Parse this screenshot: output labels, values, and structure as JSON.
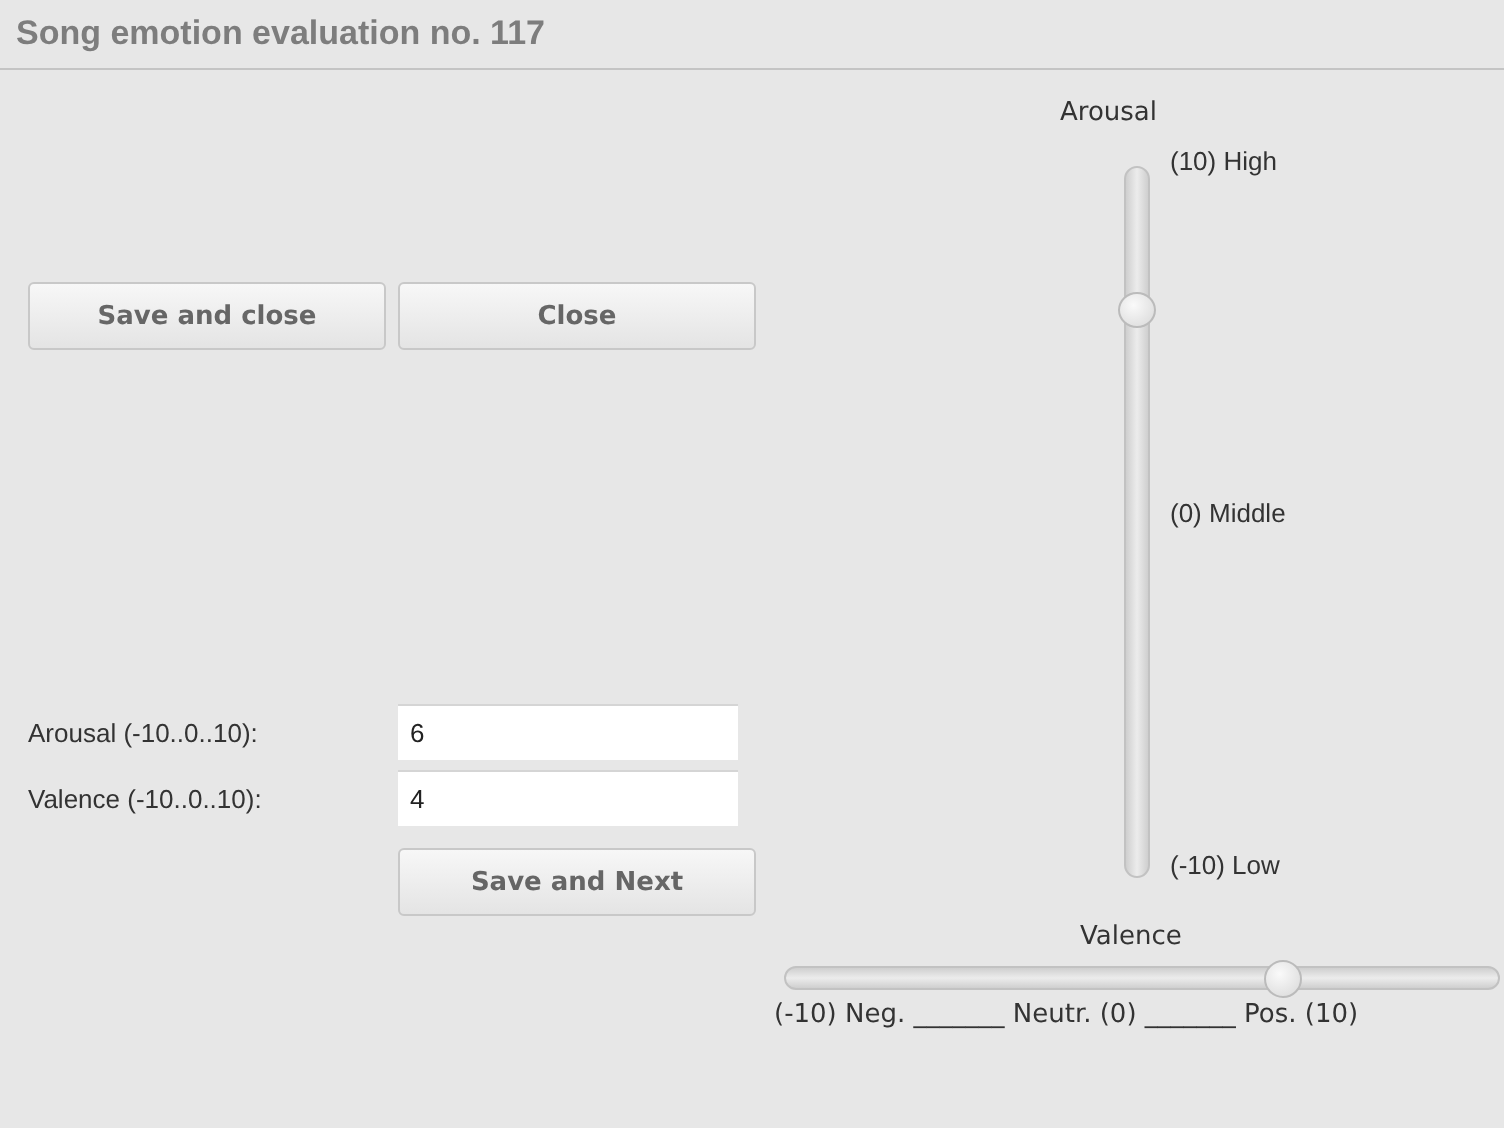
{
  "window": {
    "title": "Song emotion evaluation no. 117"
  },
  "actions": [
    {
      "label": "Save and close"
    },
    {
      "label": "Close"
    }
  ],
  "form": {
    "fields": [
      {
        "label": "Arousal (-10..0..10):",
        "value": "6"
      },
      {
        "label": "Valence (-10..0..10):",
        "value": "4"
      }
    ],
    "submit": "Save and Next"
  },
  "arousal_slider": {
    "title": "Arousal",
    "level": 0.8,
    "labels": [
      "(10) High",
      "(0) Middle",
      "(-10) Low"
    ]
  },
  "valence_slider": {
    "title": "Valence",
    "level": 0.7,
    "scale": "(-10) Neg. _______ Neutr. (0) _______ Pos. (10)"
  }
}
